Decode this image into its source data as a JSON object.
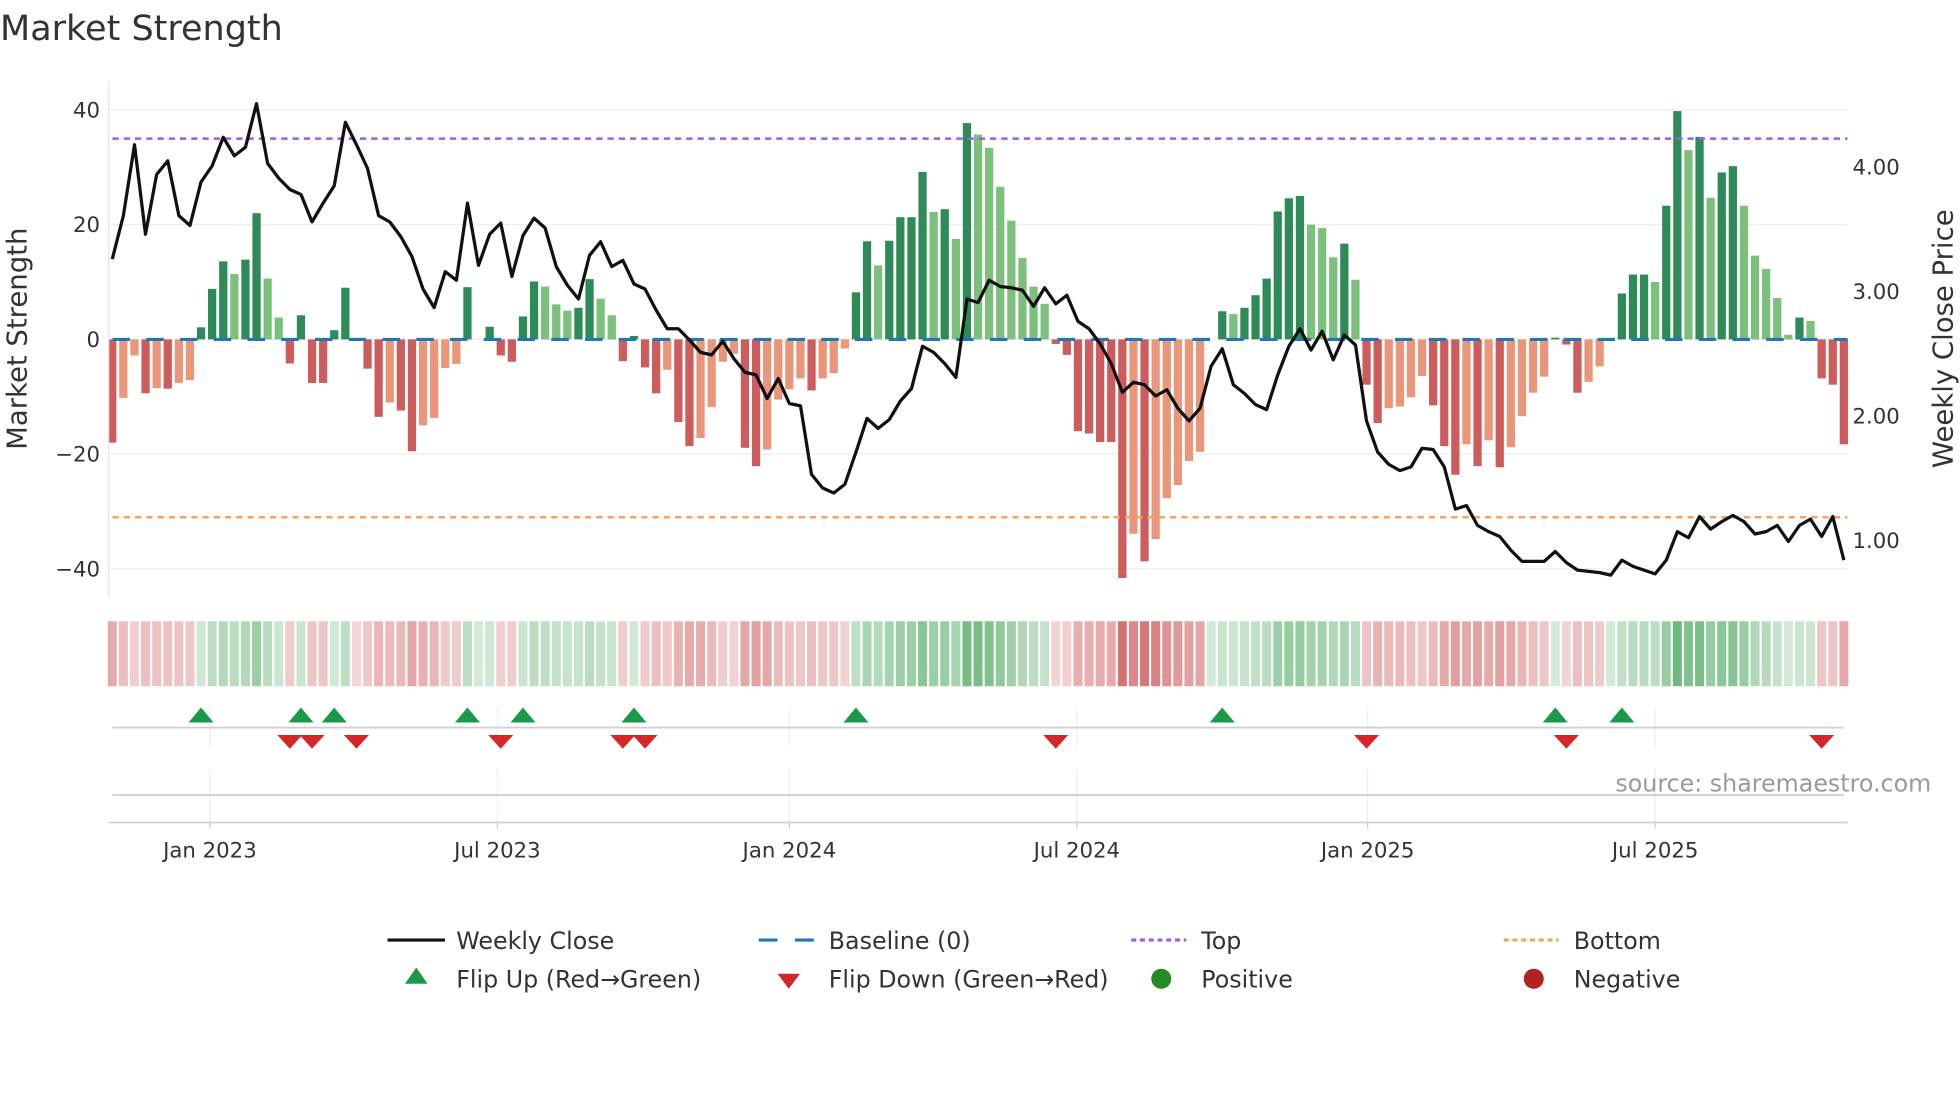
{
  "chart_data": {
    "type": "bar",
    "title": "Market Strength",
    "ylabel": "Market Strength",
    "y2label": "Weekly Close Price",
    "ylim": [
      -45,
      45
    ],
    "y2lim": [
      0.54,
      4.69
    ],
    "y_ticks": [
      {
        "v": 40,
        "label": "40"
      },
      {
        "v": 20,
        "label": "20"
      },
      {
        "v": 0,
        "label": "0"
      },
      {
        "v": -20,
        "label": "−20"
      },
      {
        "v": -40,
        "label": "−40"
      }
    ],
    "y2_ticks": [
      {
        "v": 4,
        "label": "4.00"
      },
      {
        "v": 3,
        "label": "3.00"
      },
      {
        "v": 2,
        "label": "2.00"
      },
      {
        "v": 1,
        "label": "1.00"
      }
    ],
    "x_ticks": [
      {
        "week": 8.8,
        "label": "Jan 2023"
      },
      {
        "week": 34.7,
        "label": "Jul 2023"
      },
      {
        "week": 61.0,
        "label": "Jan 2024"
      },
      {
        "week": 86.9,
        "label": "Jul 2024"
      },
      {
        "week": 113.1,
        "label": "Jan 2025"
      },
      {
        "week": 139.0,
        "label": "Jul 2025"
      }
    ],
    "top_level": 35,
    "bottom_level": -31,
    "baseline": 0,
    "strength": [
      -18,
      -10.2,
      -2.8,
      -9.4,
      -8.5,
      -8.6,
      -7.6,
      -7.1,
      2.1,
      8.8,
      13.6,
      11.4,
      13.9,
      22,
      10.6,
      3.8,
      -4.2,
      4.2,
      -7.6,
      -7.6,
      1.6,
      9.0,
      -0.3,
      -5.1,
      -13.5,
      -11,
      -12.4,
      -19.5,
      -15,
      -13.7,
      -5,
      -4.3,
      9.1,
      0,
      2.2,
      -2.8,
      -3.9,
      4,
      10.1,
      9.2,
      6.1,
      5.0,
      5.5,
      10.5,
      7.1,
      4.2,
      -3.8,
      0.6,
      -4.9,
      -9.4,
      -5.3,
      -14.4,
      -18.6,
      -17.2,
      -11.8,
      -3.9,
      -2.5,
      -18.9,
      -22.1,
      -19.2,
      -10.5,
      -8.7,
      -6.8,
      -8.9,
      -6.8,
      -5.9,
      -1.6,
      8.2,
      17.1,
      12.9,
      17.2,
      21.3,
      21.3,
      29.2,
      22.2,
      22.7,
      17.5,
      37.7,
      35.7,
      33.4,
      26.6,
      20.7,
      14.2,
      9.2,
      6.2,
      -0.8,
      -2.7,
      -16,
      -16.4,
      -17.9,
      -17.9,
      -41.6,
      -33.9,
      -38.7,
      -34.8,
      -27.7,
      -25.4,
      -21.2,
      -19.6,
      0,
      4.9,
      4.4,
      5.5,
      7.7,
      10.6,
      22.3,
      24.6,
      25,
      20,
      19.4,
      14.3,
      16.7,
      10.4,
      -7.9,
      -14.6,
      -12,
      -11.7,
      -10.1,
      -6.4,
      -11.5,
      -18.6,
      -23.6,
      -18.3,
      -22.1,
      -17.6,
      -22.3,
      -18.8,
      -13.4,
      -9.3,
      -6.5,
      0.3,
      -0.9,
      -9.3,
      -7.4,
      -4.7,
      0,
      8,
      11.3,
      11.3,
      10,
      23.3,
      39.8,
      33,
      35.3,
      24.7,
      29.1,
      30.2,
      23.3,
      14.6,
      12.3,
      7.2,
      0.8,
      3.8,
      3.2,
      -6.8,
      -7.9,
      -18.3
    ],
    "weekly_close": [
      3.26,
      3.61,
      4.18,
      3.46,
      3.94,
      4.05,
      3.61,
      3.53,
      3.88,
      4.01,
      4.24,
      4.09,
      4.16,
      4.51,
      4.03,
      3.91,
      3.82,
      3.78,
      3.56,
      3.71,
      3.85,
      4.36,
      4.18,
      3.99,
      3.61,
      3.56,
      3.44,
      3.28,
      3.02,
      2.87,
      3.16,
      3.09,
      3.71,
      3.21,
      3.46,
      3.55,
      3.12,
      3.45,
      3.59,
      3.51,
      3.2,
      3.05,
      2.94,
      3.29,
      3.4,
      3.2,
      3.25,
      3.06,
      3.02,
      2.85,
      2.7,
      2.7,
      2.61,
      2.51,
      2.49,
      2.6,
      2.46,
      2.35,
      2.33,
      2.14,
      2.3,
      2.1,
      2.08,
      1.53,
      1.42,
      1.38,
      1.45,
      1.71,
      1.98,
      1.9,
      1.97,
      2.12,
      2.22,
      2.56,
      2.51,
      2.42,
      2.31,
      2.94,
      2.91,
      3.09,
      3.04,
      3.03,
      3.01,
      2.88,
      3.03,
      2.9,
      2.97,
      2.76,
      2.7,
      2.58,
      2.42,
      2.19,
      2.27,
      2.25,
      2.16,
      2.21,
      2.06,
      1.96,
      2.06,
      2.4,
      2.54,
      2.25,
      2.18,
      2.09,
      2.05,
      2.33,
      2.56,
      2.7,
      2.53,
      2.68,
      2.45,
      2.65,
      2.57,
      1.96,
      1.71,
      1.61,
      1.56,
      1.59,
      1.74,
      1.73,
      1.59,
      1.25,
      1.28,
      1.12,
      1.07,
      1.03,
      0.92,
      0.83,
      0.83,
      0.83,
      0.91,
      0.82,
      0.76,
      0.75,
      0.74,
      0.72,
      0.84,
      0.79,
      0.76,
      0.73,
      0.84,
      1.07,
      1.02,
      1.19,
      1.09,
      1.15,
      1.2,
      1.15,
      1.05,
      1.07,
      1.12,
      0.99,
      1.12,
      1.17,
      1.03,
      1.19,
      0.84
    ],
    "flip_up_weeks": [
      9,
      18,
      21,
      33,
      38,
      48,
      68,
      101,
      131,
      137
    ],
    "flip_down_weeks": [
      17,
      19,
      23,
      36,
      47,
      49,
      86,
      114,
      132,
      155
    ],
    "legend_placement": "bottom",
    "colors": {
      "pos_strong": "#2e8b57",
      "pos_weak": "#7dbf7d",
      "neg_strong": "#cd5c5c",
      "neg_weak": "#e9967a",
      "line": "#111111",
      "baseline": "#1f77b4",
      "top": "#9b5fe0",
      "bottom": "#f4a460",
      "flip_up": "#1a9a48",
      "flip_down": "#d62728",
      "positive": "#228b22",
      "negative": "#b22222"
    }
  },
  "legend": {
    "weekly_close": "Weekly Close",
    "baseline": "Baseline (0)",
    "top": "Top",
    "bottom": "Bottom",
    "flip_up": "Flip Up (Red→Green)",
    "flip_down": "Flip Down (Green→Red)",
    "positive": "Positive",
    "negative": "Negative"
  },
  "source": "source: sharemaestro.com"
}
